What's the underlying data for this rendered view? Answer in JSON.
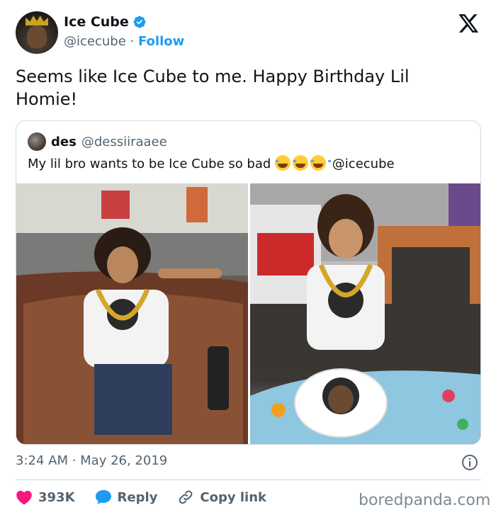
{
  "author": {
    "name": "Ice Cube",
    "handle": "@icecube",
    "separator": "·",
    "follow_label": "Follow",
    "verified_icon": "verified-badge-icon"
  },
  "tweet": {
    "text": "Seems like Ice Cube to me. Happy Birthday Lil Homie!"
  },
  "quoted": {
    "name": "des",
    "handle": "@dessiiraaee",
    "text": "My lil bro wants to be Ice Cube so bad",
    "emoji": [
      "😂",
      "😂",
      "😂"
    ],
    "mention": "@icecube"
  },
  "meta": {
    "timestamp": "3:24 AM · May 26, 2019"
  },
  "actions": {
    "like_count": "393K",
    "reply_label": "Reply",
    "copy_label": "Copy link"
  },
  "watermark": "boredpanda.com",
  "colors": {
    "text": "#0f1419",
    "secondary": "#536471",
    "accent": "#1d9bf0",
    "like": "#f91880",
    "border": "#cfd9de"
  }
}
